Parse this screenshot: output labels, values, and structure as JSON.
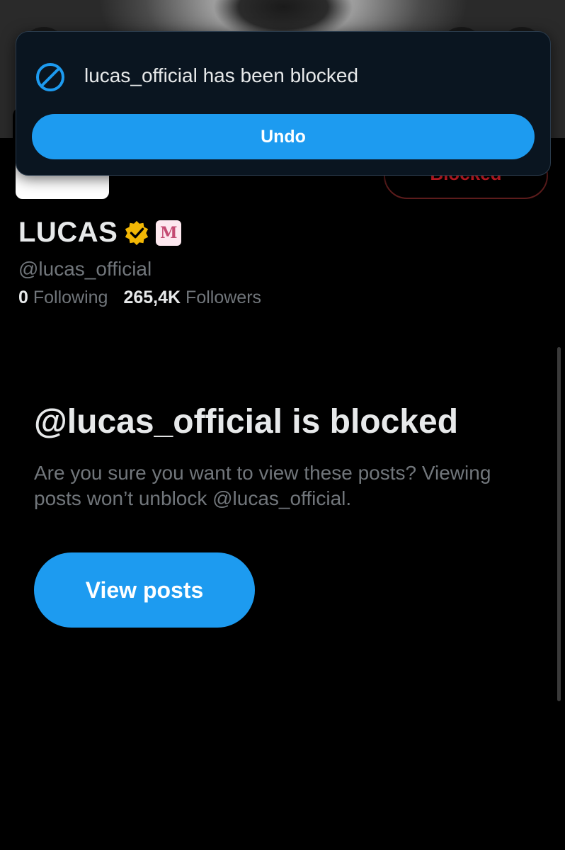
{
  "toast": {
    "message": "lucas_official has been blocked",
    "undo_label": "Undo",
    "icon": "block-icon"
  },
  "profile": {
    "blocked_button_label": "Blocked",
    "display_name": "LUCAS",
    "verified_icon": "verified-badge-icon",
    "verified_color": "#f2b705",
    "affiliate_badge_glyph": "M",
    "handle": "@lucas_official",
    "following_count": "0",
    "following_label": "Following",
    "followers_count": "265,4K",
    "followers_label": "Followers"
  },
  "blocked_notice": {
    "title": "@lucas_official is blocked",
    "description": "Are you sure you want to view these posts? Viewing posts won’t unblock @lucas_official.",
    "view_posts_label": "View posts"
  },
  "colors": {
    "accent": "#1d9bf0",
    "danger": "#f4212e",
    "background": "#000000",
    "muted_text": "#71767b",
    "primary_text": "#e7e9ea"
  }
}
